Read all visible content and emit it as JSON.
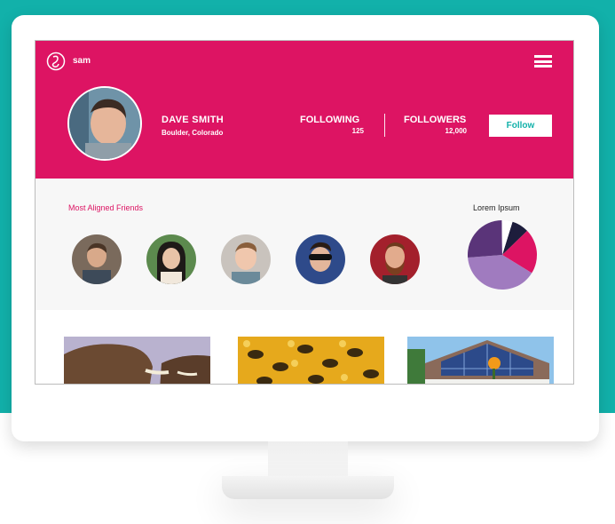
{
  "app": {
    "brand": "sam"
  },
  "profile": {
    "name": "DAVE SMITH",
    "location": "Boulder, Colorado",
    "following_label": "FOLLOWING",
    "following_count": "125",
    "followers_label": "FOLLOWERS",
    "followers_count": "12,000",
    "follow_button": "Follow"
  },
  "friends": {
    "title": "Most Aligned Friends",
    "items": [
      {
        "name": "friend-1"
      },
      {
        "name": "friend-2"
      },
      {
        "name": "friend-3"
      },
      {
        "name": "friend-4"
      },
      {
        "name": "friend-5"
      }
    ]
  },
  "chart_data": {
    "type": "pie",
    "title": "Lorem Ipsum",
    "values": [
      8,
      21,
      40,
      26,
      5
    ],
    "colors": [
      "#1d1d3c",
      "#dd1463",
      "#a07bbf",
      "#5a3479",
      "#ffffff"
    ]
  },
  "gallery": {
    "items": [
      {
        "name": "elephant-image"
      },
      {
        "name": "bees-image"
      },
      {
        "name": "solar-house-image"
      }
    ]
  },
  "colors": {
    "accent": "#dd1463",
    "teal": "#12b1aa",
    "pie_dark": "#5a3479",
    "pie_light": "#a07bbf"
  }
}
